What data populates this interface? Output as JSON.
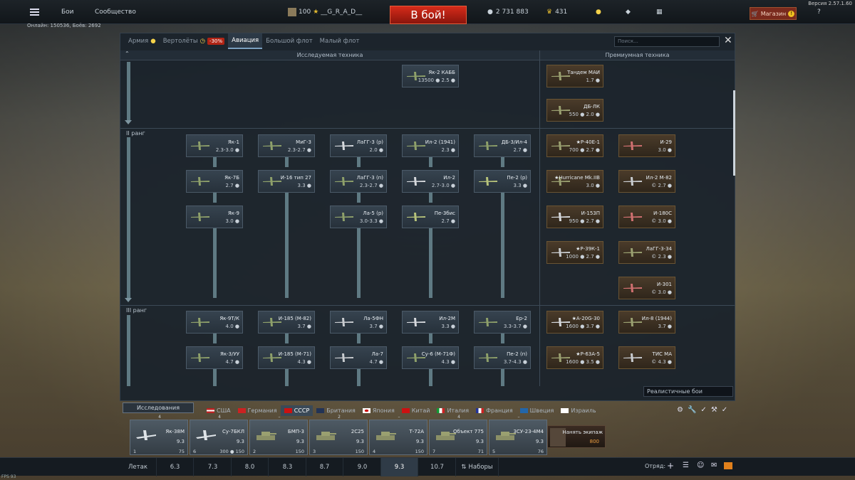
{
  "version": "Версия 2.57.1.60",
  "online": "Онлайн: 150536, Боёв: 2692",
  "top": {
    "nav_battles": "Бои",
    "nav_community": "Сообщество",
    "player_level": "100",
    "player_name": "__G_R_A_D__",
    "battle_button": "В бой!",
    "silver": "2 731 883",
    "eagles": "431",
    "shop": "Магазин"
  },
  "tabs": [
    {
      "label": "Армия"
    },
    {
      "label": "Вертолёты"
    },
    {
      "label": "Авиация"
    },
    {
      "label": "Большой флот"
    },
    {
      "label": "Малый флот"
    }
  ],
  "discount": "-30%",
  "search_placeholder": "Поиск...",
  "headers": {
    "research": "Исследуемая техника",
    "premium": "Премиумная техника"
  },
  "ranks": {
    "r2": "II ранг",
    "r3": "III ранг"
  },
  "research_cards": [
    {
      "name": "Як-2 КАББ",
      "br": "13500 ● 2.5 ●"
    },
    {
      "name": "Як-1",
      "br": "2.3-3.0 ●"
    },
    {
      "name": "МиГ-3",
      "br": "2.3-2.7 ●"
    },
    {
      "name": "ЛаГГ-3 (р)",
      "br": "2.0 ●"
    },
    {
      "name": "Ил-2 (1941)",
      "br": "2.3 ●"
    },
    {
      "name": "ДБ-3/Ил-4",
      "br": "2.7 ●"
    },
    {
      "name": "Як-7Б",
      "br": "2.7 ●"
    },
    {
      "name": "И-16 тип 27",
      "br": "3.3 ●"
    },
    {
      "name": "ЛаГГ-3 (п)",
      "br": "2.3-2.7 ●"
    },
    {
      "name": "Ил-2",
      "br": "2.7-3.0 ●"
    },
    {
      "name": "Пе-2 (р)",
      "br": "3.3 ●"
    },
    {
      "name": "Як-9",
      "br": "3.0 ●"
    },
    {
      "name": "Ла-5 (р)",
      "br": "3.0-3.3 ●"
    },
    {
      "name": "Пе-3бис",
      "br": "2.7 ●"
    },
    {
      "name": "Як-9Т/К",
      "br": "4.0 ●"
    },
    {
      "name": "И-185 (М-82)",
      "br": "3.7 ●"
    },
    {
      "name": "Ла-5ФН",
      "br": "3.7 ●"
    },
    {
      "name": "Ил-2М",
      "br": "3.3 ●"
    },
    {
      "name": "Ер-2",
      "br": "3.3-3.7 ●"
    },
    {
      "name": "Як-3/УУ",
      "br": "4.7 ●"
    },
    {
      "name": "И-185 (М-71)",
      "br": "4.3 ●"
    },
    {
      "name": "Ла-7",
      "br": "4.7 ●"
    },
    {
      "name": "Су-6 (М-71Ф)",
      "br": "4.3 ●"
    },
    {
      "name": "Пе-2 (п)",
      "br": "3.7-4.3 ●"
    }
  ],
  "premium_cards": [
    {
      "name": "Тандем МАИ",
      "br": "1.7 ●"
    },
    {
      "name": "ДБ-ЛК",
      "br": "550 ● 2.0 ●"
    },
    {
      "name": "★Р-40Е-1",
      "br": "700 ● 2.7 ●"
    },
    {
      "name": "И-29",
      "br": "3.0 ●"
    },
    {
      "name": "★Hurricane Mk.IIB",
      "br": "3.0 ●"
    },
    {
      "name": "Ил-2 М-82",
      "br": "© 2.7 ●"
    },
    {
      "name": "И-153П",
      "br": "950 ● 2.7 ●"
    },
    {
      "name": "И-180С",
      "br": "© 3.0 ●"
    },
    {
      "name": "★Р-39К-1",
      "br": "1000 ● 2.7 ●"
    },
    {
      "name": "ЛаГГ-3-34",
      "br": "© 2.3 ●"
    },
    {
      "name": "И-301",
      "br": "© 3.0 ●"
    },
    {
      "name": "★А-20G-30",
      "br": "1600 ● 3.7 ●"
    },
    {
      "name": "Ил-8 (1944)",
      "br": "3.7 ●"
    },
    {
      "name": "★Р-63А-5",
      "br": "1600 ● 3.5 ●"
    },
    {
      "name": "ТИС МА",
      "br": "© 4.3 ●"
    }
  ],
  "mode": "Реалистичные бои",
  "research_toggle": "Исследования",
  "nations": [
    {
      "label": "США"
    },
    {
      "label": "Германия"
    },
    {
      "label": "СССР"
    },
    {
      "label": "Британия"
    },
    {
      "label": "Япония"
    },
    {
      "label": "Китай"
    },
    {
      "label": "Италия"
    },
    {
      "label": "Франция"
    },
    {
      "label": "Швеция"
    },
    {
      "label": "Израиль"
    }
  ],
  "slots": [
    {
      "count": "4",
      "name": "Як-38М",
      "br": "9.3",
      "crew": "1",
      "footer": "75"
    },
    {
      "count": "4",
      "name": "Су-7БКЛ",
      "br": "9.3",
      "crew": "6",
      "footer": "300 ● 150"
    },
    {
      "count": "–",
      "name": "БМП-3",
      "br": "9.3",
      "crew": "2",
      "footer": "150"
    },
    {
      "count": "2",
      "name": "2С25",
      "br": "9.3",
      "crew": "3",
      "footer": "150"
    },
    {
      "count": "–",
      "name": "Т-72А",
      "br": "9.3",
      "crew": "4",
      "footer": "150"
    },
    {
      "count": "4",
      "name": "Объект 775",
      "br": "9.3",
      "crew": "7",
      "footer": "71"
    },
    {
      "count": "–",
      "name": "ЗСУ-23-4М4",
      "br": "9.3",
      "crew": "5",
      "footer": "76"
    }
  ],
  "crew": {
    "label": "Нанять экипаж",
    "cost": "800"
  },
  "bottom": {
    "letak": "Летак",
    "brs": [
      "6.3",
      "7.3",
      "8.0",
      "8.3",
      "8.7",
      "9.0",
      "9.3",
      "10.7"
    ],
    "sets": "Наборы",
    "squad": "Отряд:"
  },
  "fps": "FPS 93",
  "colors": {
    "accent": "#b02415",
    "panel": "#1b232c",
    "premium": "#4a3b2a"
  }
}
